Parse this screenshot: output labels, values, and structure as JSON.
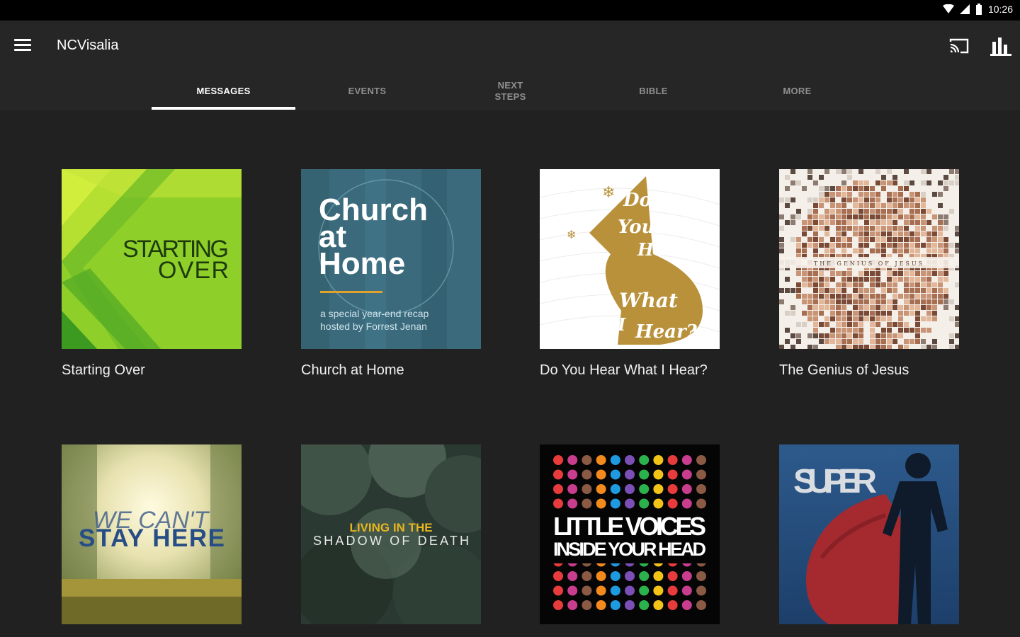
{
  "status_bar": {
    "time": "10:26"
  },
  "app_bar": {
    "title": "NCVisalia",
    "icons": [
      "menu-icon",
      "cast-icon",
      "bar-chart-icon"
    ]
  },
  "tabs": [
    {
      "label": "MESSAGES",
      "active": true
    },
    {
      "label": "EVENTS",
      "active": false
    },
    {
      "label": "NEXT\nSTEPS",
      "active": false
    },
    {
      "label": "BIBLE",
      "active": false
    },
    {
      "label": "MORE",
      "active": false
    }
  ],
  "series": [
    {
      "title": "Starting Over",
      "art_text": [
        "STARTING",
        "OVER"
      ]
    },
    {
      "title": "Church at Home",
      "art_text": [
        "Church",
        "at",
        "Home",
        "a special year-end recap",
        "hosted by Forrest Jenan"
      ]
    },
    {
      "title": "Do You Hear What I Hear?",
      "art_text": [
        "Do",
        "You",
        "Hear",
        "What",
        "I",
        "Hear?"
      ]
    },
    {
      "title": "The Genius of Jesus",
      "art_text": [
        "THE GENIUS OF JESUS"
      ]
    },
    {
      "title": "",
      "art_text": [
        "WE CAN'T",
        "STAY HERE"
      ]
    },
    {
      "title": "",
      "art_text": [
        "LIVING IN THE",
        "SHADOW OF DEATH"
      ]
    },
    {
      "title": "",
      "art_text": [
        "LITTLE VOICES",
        "INSIDE YOUR HEAD"
      ]
    },
    {
      "title": "",
      "art_text": [
        "SUPER"
      ]
    }
  ]
}
